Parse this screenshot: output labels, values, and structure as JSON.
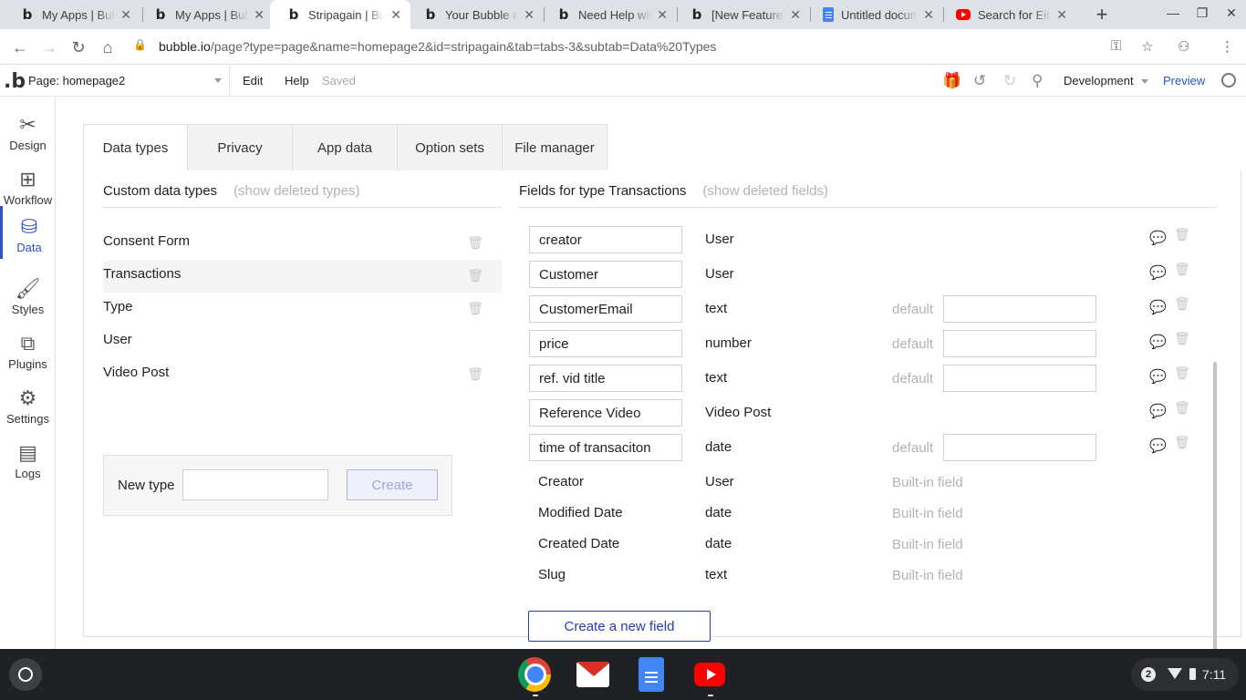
{
  "browser": {
    "tabs": [
      {
        "title": "My Apps | Bubble",
        "icon": "bubble-icon"
      },
      {
        "title": "My Apps | Bubble",
        "icon": "bubble-icon"
      },
      {
        "title": "Stripagain | Bubble",
        "icon": "bubble-icon"
      },
      {
        "title": "Your Bubble apps",
        "icon": "bubble-icon"
      },
      {
        "title": "Need Help with",
        "icon": "bubble-icon"
      },
      {
        "title": "[New Feature] D",
        "icon": "bubble-icon"
      },
      {
        "title": "Untitled docume",
        "icon": "docs-icon"
      },
      {
        "title": "Search for Eithe",
        "icon": "youtube-icon"
      }
    ],
    "active_tab": 2,
    "url_host": "bubble.io",
    "url_path": "/page?type=page&name=homepage2&id=stripagain&tab=tabs-3&subtab=Data%20Types"
  },
  "editor": {
    "page_select": "Page: homepage2",
    "menu_edit": "Edit",
    "menu_help": "Help",
    "saved_status": "Saved",
    "environment": "Development",
    "preview": "Preview"
  },
  "sidebar": {
    "items": [
      {
        "label": "Design",
        "icon": "design-icon"
      },
      {
        "label": "Workflow",
        "icon": "workflow-icon"
      },
      {
        "label": "Data",
        "icon": "database-icon"
      },
      {
        "label": "Styles",
        "icon": "brush-icon"
      },
      {
        "label": "Plugins",
        "icon": "plugin-icon"
      },
      {
        "label": "Settings",
        "icon": "gear-icon"
      },
      {
        "label": "Logs",
        "icon": "logs-icon"
      }
    ],
    "active": "Data"
  },
  "data_tabs": [
    "Data types",
    "Privacy",
    "App data",
    "Option sets",
    "File manager"
  ],
  "custom_types": {
    "header": "Custom data types",
    "show_deleted": "(show deleted types)",
    "items": [
      {
        "name": "Consent Form",
        "deletable": true
      },
      {
        "name": "Transactions",
        "deletable": true,
        "selected": true
      },
      {
        "name": "Type",
        "deletable": true
      },
      {
        "name": "User",
        "deletable": false
      },
      {
        "name": "Video Post",
        "deletable": true
      }
    ],
    "new_type_label": "New type",
    "new_type_value": "",
    "create_button": "Create"
  },
  "fields": {
    "header": "Fields for type Transactions",
    "show_deleted": "(show deleted fields)",
    "custom": [
      {
        "name": "creator",
        "type": "User",
        "default_label": ""
      },
      {
        "name": "Customer",
        "type": "User",
        "default_label": ""
      },
      {
        "name": "CustomerEmail",
        "type": "text",
        "default_label": "default"
      },
      {
        "name": "price",
        "type": "number",
        "default_label": "default"
      },
      {
        "name": "ref. vid title",
        "type": "text",
        "default_label": "default"
      },
      {
        "name": "Reference Video",
        "type": "Video Post",
        "default_label": ""
      },
      {
        "name": "time of transaciton",
        "type": "date",
        "default_label": "default"
      }
    ],
    "builtin": [
      {
        "name": "Creator",
        "type": "User",
        "note": "Built-in field"
      },
      {
        "name": "Modified Date",
        "type": "date",
        "note": "Built-in field"
      },
      {
        "name": "Created Date",
        "type": "date",
        "note": "Built-in field"
      },
      {
        "name": "Slug",
        "type": "text",
        "note": "Built-in field"
      }
    ],
    "create_button": "Create a new field"
  },
  "shelf": {
    "notification_count": "2",
    "time": "7:11"
  },
  "colors": {
    "accent": "#2b52c8",
    "muted_text": "#b3b3b3",
    "shelf": "#202124"
  }
}
